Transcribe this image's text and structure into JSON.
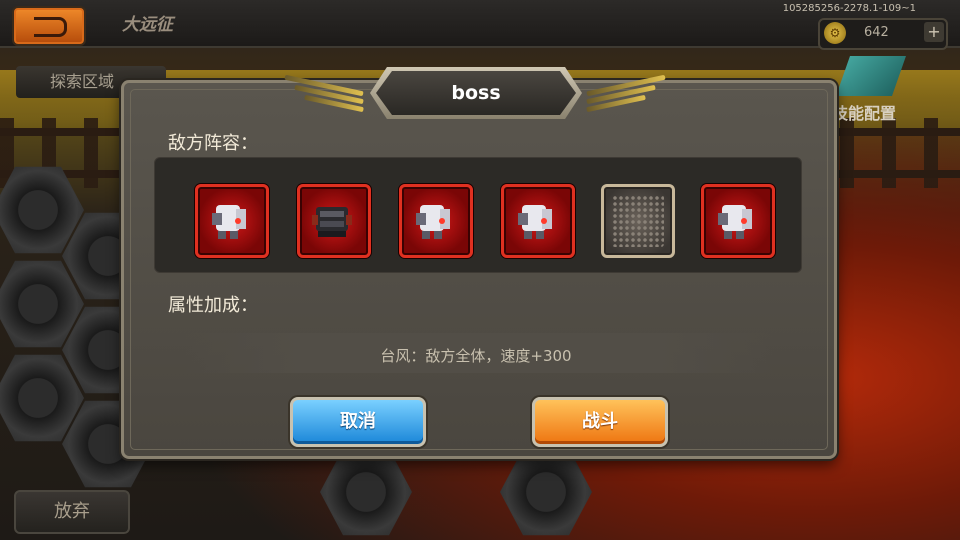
{
  "topbar": {
    "title": "大远征",
    "build_id": "105285256-2278.1-109~1",
    "coins": "642",
    "plus_label": "+",
    "coin_icon": "gear-coin-icon"
  },
  "explore_tab": {
    "label": "探索区域"
  },
  "skill_config": {
    "label": "技能配置",
    "icon": "skill-emblem-icon"
  },
  "abandon_button": {
    "label": "放弃"
  },
  "dialog": {
    "title": "boss",
    "enemy_lineup_label": "敌方阵容：",
    "enemy_slots": [
      {
        "type": "mech-white",
        "empty": false
      },
      {
        "type": "mech-dark",
        "empty": false
      },
      {
        "type": "mech-white",
        "empty": false
      },
      {
        "type": "mech-white",
        "empty": false
      },
      {
        "type": "empty-slot",
        "empty": true
      },
      {
        "type": "mech-white",
        "empty": false
      }
    ],
    "attribute_bonus_label": "属性加成：",
    "bonus_text": "台风：敌方全体，速度+300",
    "cancel_label": "取消",
    "fight_label": "战斗"
  },
  "colors": {
    "cancel_button": "#1a86d8",
    "fight_button": "#ee7410",
    "enemy_slot_border": "#e03020"
  }
}
